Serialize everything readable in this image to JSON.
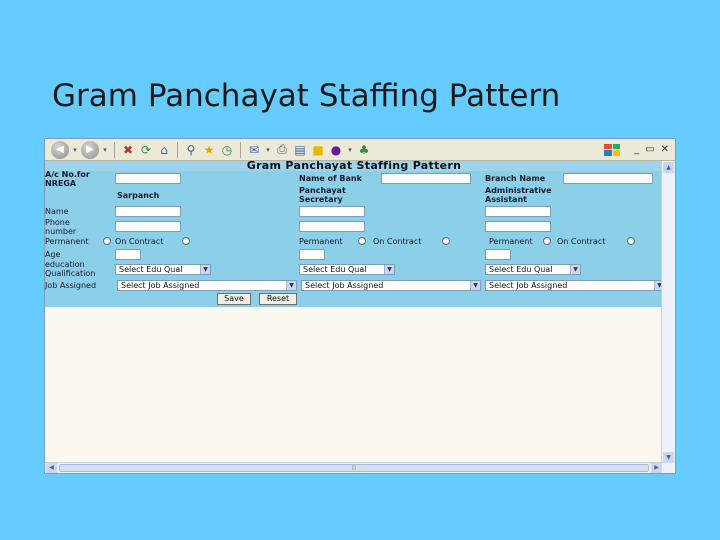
{
  "slide": {
    "title": "Gram Panchayat Staffing Pattern"
  },
  "browser": {
    "toolbar_icons": [
      "back-icon",
      "forward-icon",
      "stop-icon",
      "refresh-icon",
      "home-icon",
      "search-icon",
      "favorites-icon",
      "history-icon",
      "mail-icon",
      "print-icon",
      "edit-icon",
      "notes-icon",
      "yahoo-icon",
      "messenger-icon"
    ],
    "window_controls": [
      "_",
      "▭",
      "✕"
    ]
  },
  "page": {
    "title": "Gram Panchayat Staffing Pattern",
    "labels": {
      "ac_no": "A/c No.for",
      "nrega": "NREGA",
      "name_of_bank": "Name of Bank",
      "branch_name": "Branch Name",
      "sarpanch": "Sarpanch",
      "panchayat": "Panchayat",
      "secretary": "Secretary",
      "administrative": "Administrative",
      "assistant": "Assistant",
      "name": "Name",
      "phone": "Phone",
      "number": "number",
      "age": "Age",
      "education": "education",
      "qualification": "Qualification",
      "job_assigned": "Job Assigned"
    },
    "col1": {
      "permanent": "Permanent",
      "on_contract": "On Contract",
      "edu_select": "Select Edu Qual",
      "job_select": "Select Job Assigned"
    },
    "col2": {
      "permanent": "Permanent",
      "on_contract": "On Contract",
      "edu_select": "Select Edu Qual",
      "job_select": "Select Job Assigned"
    },
    "col3": {
      "permanent": "Permanent",
      "on_contract": "On Contract",
      "edu_select": "Select Edu Qual",
      "job_select": "Select Job Assigned"
    },
    "buttons": {
      "save": "Save",
      "reset": "Reset"
    }
  }
}
